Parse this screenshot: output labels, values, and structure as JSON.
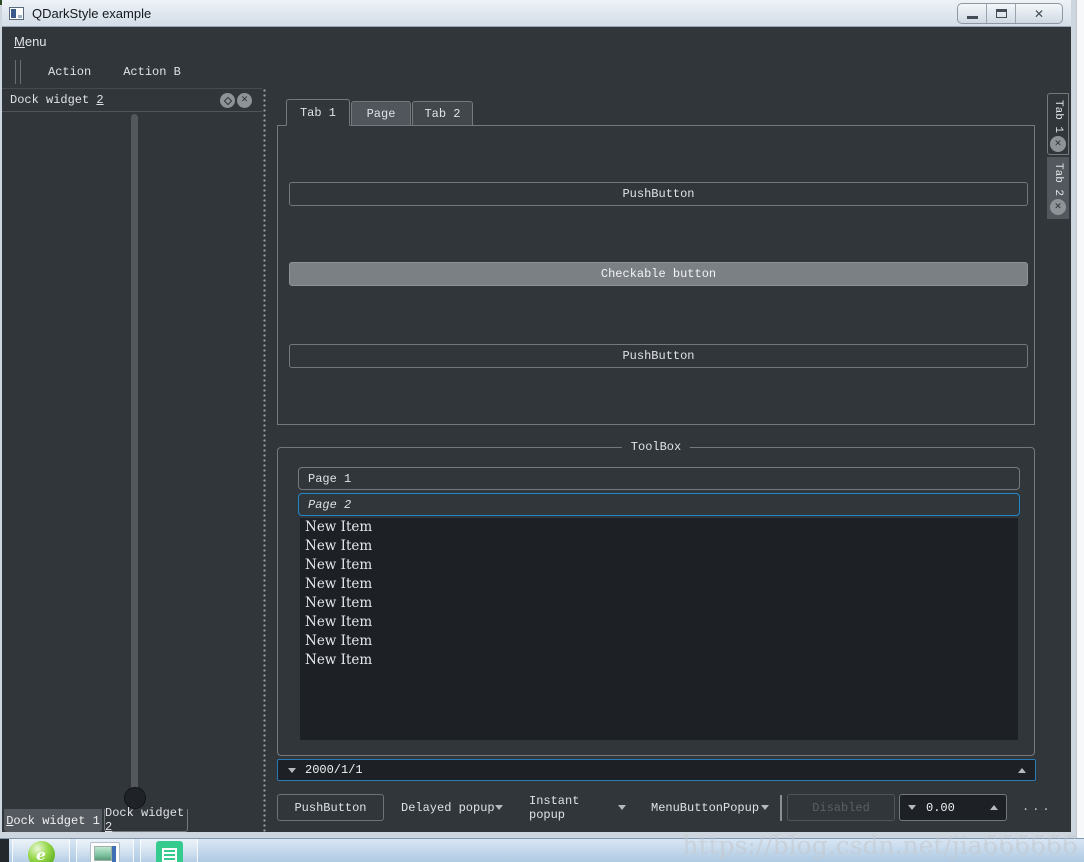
{
  "titlebar": {
    "title": "QDarkStyle example"
  },
  "icons": {
    "close_glyph": "✕"
  },
  "menubar": {
    "menu": {
      "accel": "M",
      "rest": "enu"
    }
  },
  "toolbar": {
    "action1": "Action",
    "action2": "Action B"
  },
  "dock": {
    "title": {
      "prefix": "Dock widget ",
      "accel": "2"
    },
    "tab1": {
      "accel": "D",
      "rest": "ock widget 1"
    },
    "tab2": {
      "prefix": "Dock widget ",
      "accel": "2"
    }
  },
  "tabbar": {
    "tab1": "Tab 1",
    "tab2": "Page",
    "tab3": "Tab 2"
  },
  "tab_page": {
    "push1": "PushButton",
    "checkable": "Checkable button",
    "push2": "PushButton"
  },
  "toolbox": {
    "title": "ToolBox",
    "page1": "Page 1",
    "page2": "Page 2",
    "items": [
      "New Item",
      "New Item",
      "New Item",
      "New Item",
      "New Item",
      "New Item",
      "New Item",
      "New Item"
    ]
  },
  "date_edit": {
    "value": "2000/1/1"
  },
  "bottom_toolbar": {
    "push": "PushButton",
    "delayed": "Delayed popup",
    "instant": "Instant popup",
    "menu_popup": "MenuButtonPopup",
    "disabled": "Disabled",
    "spin_value": "0.00",
    "overflow": "..."
  },
  "right_tabs": {
    "tab1": "Tab 1",
    "tab2": "Tab 2"
  },
  "watermark": "https://blog.csdn.net/jia666666",
  "colors": {
    "bg": "#31363b",
    "bg_dark": "#1d2125",
    "border": "#76797c",
    "accent_blue": "#2186c8",
    "checked_gray": "#7b8085",
    "titlebar_light": "#e3eaf2",
    "taskbar_blue": "#bcd2e8"
  }
}
